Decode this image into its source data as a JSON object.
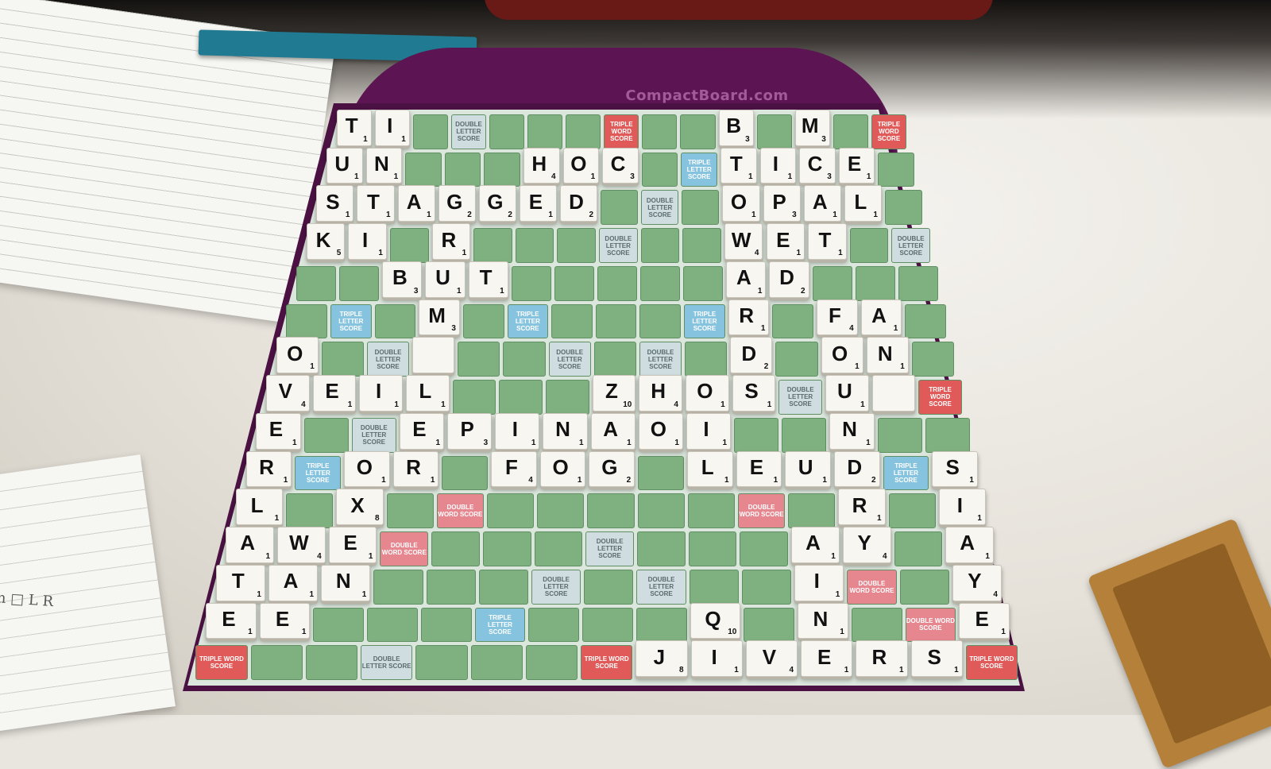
{
  "brand": "CompactBoard.com",
  "notes_scribble": "m □ L R",
  "colors": {
    "square": "#7fb07f",
    "double_letter": "#cfdde0",
    "triple_letter": "#86c3df",
    "double_word": "#e6868f",
    "triple_word": "#df5a58",
    "tile": "#f7f6f1",
    "board_frame": "#5c1452"
  },
  "premium_labels": {
    "dl": "DOUBLE LETTER SCORE",
    "tl": "TRIPLE LETTER SCORE",
    "dw": "DOUBLE WORD SCORE",
    "tw": "TRIPLE WORD SCORE"
  },
  "premium_squares": [
    {
      "r": 0,
      "c": 3,
      "t": "dl"
    },
    {
      "r": 0,
      "c": 7,
      "t": "tw"
    },
    {
      "r": 0,
      "c": 14,
      "t": "tw"
    },
    {
      "r": 1,
      "c": 9,
      "t": "tl"
    },
    {
      "r": 2,
      "c": 8,
      "t": "dl"
    },
    {
      "r": 3,
      "c": 7,
      "t": "dl"
    },
    {
      "r": 3,
      "c": 14,
      "t": "dl"
    },
    {
      "r": 5,
      "c": 1,
      "t": "tl"
    },
    {
      "r": 5,
      "c": 5,
      "t": "tl"
    },
    {
      "r": 5,
      "c": 9,
      "t": "tl"
    },
    {
      "r": 6,
      "c": 2,
      "t": "dl"
    },
    {
      "r": 6,
      "c": 6,
      "t": "dl"
    },
    {
      "r": 6,
      "c": 8,
      "t": "dl"
    },
    {
      "r": 7,
      "c": 11,
      "t": "dl"
    },
    {
      "r": 7,
      "c": 14,
      "t": "tw"
    },
    {
      "r": 8,
      "c": 2,
      "t": "dl"
    },
    {
      "r": 9,
      "c": 1,
      "t": "tl"
    },
    {
      "r": 9,
      "c": 13,
      "t": "tl"
    },
    {
      "r": 10,
      "c": 4,
      "t": "dw"
    },
    {
      "r": 10,
      "c": 10,
      "t": "dw"
    },
    {
      "r": 11,
      "c": 3,
      "t": "dw"
    },
    {
      "r": 11,
      "c": 7,
      "t": "dl"
    },
    {
      "r": 12,
      "c": 6,
      "t": "dl"
    },
    {
      "r": 12,
      "c": 8,
      "t": "dl"
    },
    {
      "r": 12,
      "c": 12,
      "t": "dw"
    },
    {
      "r": 13,
      "c": 5,
      "t": "tl"
    },
    {
      "r": 13,
      "c": 13,
      "t": "dw"
    },
    {
      "r": 14,
      "c": 0,
      "t": "tw"
    },
    {
      "r": 14,
      "c": 3,
      "t": "dl"
    },
    {
      "r": 14,
      "c": 7,
      "t": "tw"
    },
    {
      "r": 14,
      "c": 14,
      "t": "tw"
    }
  ],
  "tiles": [
    {
      "r": 0,
      "c": 0,
      "l": "T",
      "p": "1"
    },
    {
      "r": 0,
      "c": 1,
      "l": "I",
      "p": "1"
    },
    {
      "r": 0,
      "c": 10,
      "l": "B",
      "p": "3"
    },
    {
      "r": 0,
      "c": 12,
      "l": "M",
      "p": "3"
    },
    {
      "r": 1,
      "c": 0,
      "l": "U",
      "p": "1"
    },
    {
      "r": 1,
      "c": 1,
      "l": "N",
      "p": "1"
    },
    {
      "r": 1,
      "c": 5,
      "l": "H",
      "p": "4"
    },
    {
      "r": 1,
      "c": 6,
      "l": "O",
      "p": "1"
    },
    {
      "r": 1,
      "c": 7,
      "l": "C",
      "p": "3"
    },
    {
      "r": 1,
      "c": 10,
      "l": "T",
      "p": "1"
    },
    {
      "r": 1,
      "c": 11,
      "l": "I",
      "p": "1"
    },
    {
      "r": 1,
      "c": 12,
      "l": "C",
      "p": "3"
    },
    {
      "r": 1,
      "c": 13,
      "l": "E",
      "p": "1"
    },
    {
      "r": 2,
      "c": 0,
      "l": "S",
      "p": "1"
    },
    {
      "r": 2,
      "c": 1,
      "l": "T",
      "p": "1"
    },
    {
      "r": 2,
      "c": 2,
      "l": "A",
      "p": "1"
    },
    {
      "r": 2,
      "c": 3,
      "l": "G",
      "p": "2"
    },
    {
      "r": 2,
      "c": 4,
      "l": "G",
      "p": "2"
    },
    {
      "r": 2,
      "c": 5,
      "l": "E",
      "p": "1"
    },
    {
      "r": 2,
      "c": 6,
      "l": "D",
      "p": "2"
    },
    {
      "r": 2,
      "c": 10,
      "l": "O",
      "p": "1"
    },
    {
      "r": 2,
      "c": 11,
      "l": "P",
      "p": "3"
    },
    {
      "r": 2,
      "c": 12,
      "l": "A",
      "p": "1"
    },
    {
      "r": 2,
      "c": 13,
      "l": "L",
      "p": "1"
    },
    {
      "r": 3,
      "c": 0,
      "l": "K",
      "p": "5"
    },
    {
      "r": 3,
      "c": 1,
      "l": "I",
      "p": "1"
    },
    {
      "r": 3,
      "c": 3,
      "l": "R",
      "p": "1"
    },
    {
      "r": 3,
      "c": 10,
      "l": "W",
      "p": "4"
    },
    {
      "r": 3,
      "c": 11,
      "l": "E",
      "p": "1"
    },
    {
      "r": 3,
      "c": 12,
      "l": "T",
      "p": "1"
    },
    {
      "r": 4,
      "c": 2,
      "l": "B",
      "p": "3"
    },
    {
      "r": 4,
      "c": 3,
      "l": "U",
      "p": "1"
    },
    {
      "r": 4,
      "c": 4,
      "l": "T",
      "p": "1"
    },
    {
      "r": 4,
      "c": 10,
      "l": "A",
      "p": "1"
    },
    {
      "r": 4,
      "c": 11,
      "l": "D",
      "p": "2"
    },
    {
      "r": 5,
      "c": 3,
      "l": "M",
      "p": "3"
    },
    {
      "r": 5,
      "c": 10,
      "l": "R",
      "p": "1"
    },
    {
      "r": 5,
      "c": 12,
      "l": "F",
      "p": "4"
    },
    {
      "r": 5,
      "c": 13,
      "l": "A",
      "p": "1"
    },
    {
      "r": 6,
      "c": 0,
      "l": "O",
      "p": "1"
    },
    {
      "r": 6,
      "c": 3,
      "l": "",
      "p": ""
    },
    {
      "r": 6,
      "c": 10,
      "l": "D",
      "p": "2"
    },
    {
      "r": 6,
      "c": 12,
      "l": "O",
      "p": "1"
    },
    {
      "r": 6,
      "c": 13,
      "l": "N",
      "p": "1"
    },
    {
      "r": 7,
      "c": 0,
      "l": "V",
      "p": "4"
    },
    {
      "r": 7,
      "c": 1,
      "l": "E",
      "p": "1"
    },
    {
      "r": 7,
      "c": 2,
      "l": "I",
      "p": "1"
    },
    {
      "r": 7,
      "c": 3,
      "l": "L",
      "p": "1"
    },
    {
      "r": 7,
      "c": 7,
      "l": "Z",
      "p": "10"
    },
    {
      "r": 7,
      "c": 8,
      "l": "H",
      "p": "4"
    },
    {
      "r": 7,
      "c": 9,
      "l": "O",
      "p": "1"
    },
    {
      "r": 7,
      "c": 10,
      "l": "S",
      "p": "1"
    },
    {
      "r": 7,
      "c": 12,
      "l": "U",
      "p": "1"
    },
    {
      "r": 7,
      "c": 13,
      "l": "",
      "p": ""
    },
    {
      "r": 8,
      "c": 0,
      "l": "E",
      "p": "1"
    },
    {
      "r": 8,
      "c": 3,
      "l": "E",
      "p": "1"
    },
    {
      "r": 8,
      "c": 4,
      "l": "P",
      "p": "3"
    },
    {
      "r": 8,
      "c": 5,
      "l": "I",
      "p": "1"
    },
    {
      "r": 8,
      "c": 6,
      "l": "N",
      "p": "1"
    },
    {
      "r": 8,
      "c": 7,
      "l": "A",
      "p": "1"
    },
    {
      "r": 8,
      "c": 8,
      "l": "O",
      "p": "1"
    },
    {
      "r": 8,
      "c": 9,
      "l": "I",
      "p": "1"
    },
    {
      "r": 8,
      "c": 12,
      "l": "N",
      "p": "1"
    },
    {
      "r": 9,
      "c": 0,
      "l": "R",
      "p": "1"
    },
    {
      "r": 9,
      "c": 2,
      "l": "O",
      "p": "1"
    },
    {
      "r": 9,
      "c": 3,
      "l": "R",
      "p": "1"
    },
    {
      "r": 9,
      "c": 5,
      "l": "F",
      "p": "4"
    },
    {
      "r": 9,
      "c": 6,
      "l": "O",
      "p": "1"
    },
    {
      "r": 9,
      "c": 7,
      "l": "G",
      "p": "2"
    },
    {
      "r": 9,
      "c": 9,
      "l": "L",
      "p": "1"
    },
    {
      "r": 9,
      "c": 10,
      "l": "E",
      "p": "1"
    },
    {
      "r": 9,
      "c": 11,
      "l": "U",
      "p": "1"
    },
    {
      "r": 9,
      "c": 12,
      "l": "D",
      "p": "2"
    },
    {
      "r": 9,
      "c": 14,
      "l": "S",
      "p": "1"
    },
    {
      "r": 10,
      "c": 0,
      "l": "L",
      "p": "1"
    },
    {
      "r": 10,
      "c": 2,
      "l": "X",
      "p": "8"
    },
    {
      "r": 10,
      "c": 12,
      "l": "R",
      "p": "1"
    },
    {
      "r": 10,
      "c": 14,
      "l": "I",
      "p": "1"
    },
    {
      "r": 11,
      "c": 0,
      "l": "A",
      "p": "1"
    },
    {
      "r": 11,
      "c": 1,
      "l": "W",
      "p": "4"
    },
    {
      "r": 11,
      "c": 2,
      "l": "E",
      "p": "1"
    },
    {
      "r": 11,
      "c": 11,
      "l": "A",
      "p": "1"
    },
    {
      "r": 11,
      "c": 12,
      "l": "Y",
      "p": "4"
    },
    {
      "r": 11,
      "c": 14,
      "l": "A",
      "p": "1"
    },
    {
      "r": 12,
      "c": 0,
      "l": "T",
      "p": "1"
    },
    {
      "r": 12,
      "c": 1,
      "l": "A",
      "p": "1"
    },
    {
      "r": 12,
      "c": 2,
      "l": "N",
      "p": "1"
    },
    {
      "r": 12,
      "c": 11,
      "l": "I",
      "p": "1"
    },
    {
      "r": 12,
      "c": 14,
      "l": "Y",
      "p": "4"
    },
    {
      "r": 13,
      "c": 0,
      "l": "E",
      "p": "1"
    },
    {
      "r": 13,
      "c": 1,
      "l": "E",
      "p": "1"
    },
    {
      "r": 13,
      "c": 9,
      "l": "Q",
      "p": "10"
    },
    {
      "r": 13,
      "c": 11,
      "l": "N",
      "p": "1"
    },
    {
      "r": 13,
      "c": 14,
      "l": "E",
      "p": "1"
    },
    {
      "r": 14,
      "c": 8,
      "l": "J",
      "p": "8"
    },
    {
      "r": 14,
      "c": 9,
      "l": "I",
      "p": "1"
    },
    {
      "r": 14,
      "c": 10,
      "l": "V",
      "p": "4"
    },
    {
      "r": 14,
      "c": 11,
      "l": "E",
      "p": "1"
    },
    {
      "r": 14,
      "c": 12,
      "l": "R",
      "p": "1"
    },
    {
      "r": 14,
      "c": 13,
      "l": "S",
      "p": "1"
    }
  ]
}
